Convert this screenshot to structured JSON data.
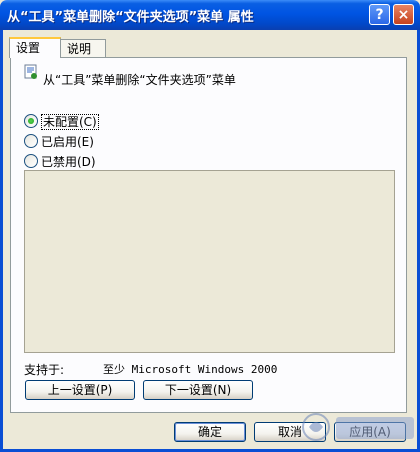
{
  "window": {
    "title": "从“工具”菜单删除“文件夹选项”菜单 属性",
    "help_button": "?",
    "close_button": "×"
  },
  "tabs": [
    {
      "label": "设置",
      "selected": true
    },
    {
      "label": "说明",
      "selected": false
    }
  ],
  "policy": {
    "name": "从“工具”菜单删除“文件夹选项”菜单",
    "icon": "policy-setting-icon"
  },
  "options": [
    {
      "label": "未配置(C)",
      "checked": true
    },
    {
      "label": "已启用(E)",
      "checked": false
    },
    {
      "label": "已禁用(D)",
      "checked": false
    }
  ],
  "supported": {
    "label": "支持于:",
    "value": "至少 Microsoft Windows 2000"
  },
  "nav_buttons": {
    "prev": "上一设置(P)",
    "next": "下一设置(N)"
  },
  "dialog_buttons": {
    "ok": "确定",
    "cancel": "取消",
    "apply": "应用(A)"
  },
  "colors": {
    "titlebar": "#0054e3",
    "dialog_bg": "#ece9d8",
    "tab_highlight": "#ffc83c"
  }
}
